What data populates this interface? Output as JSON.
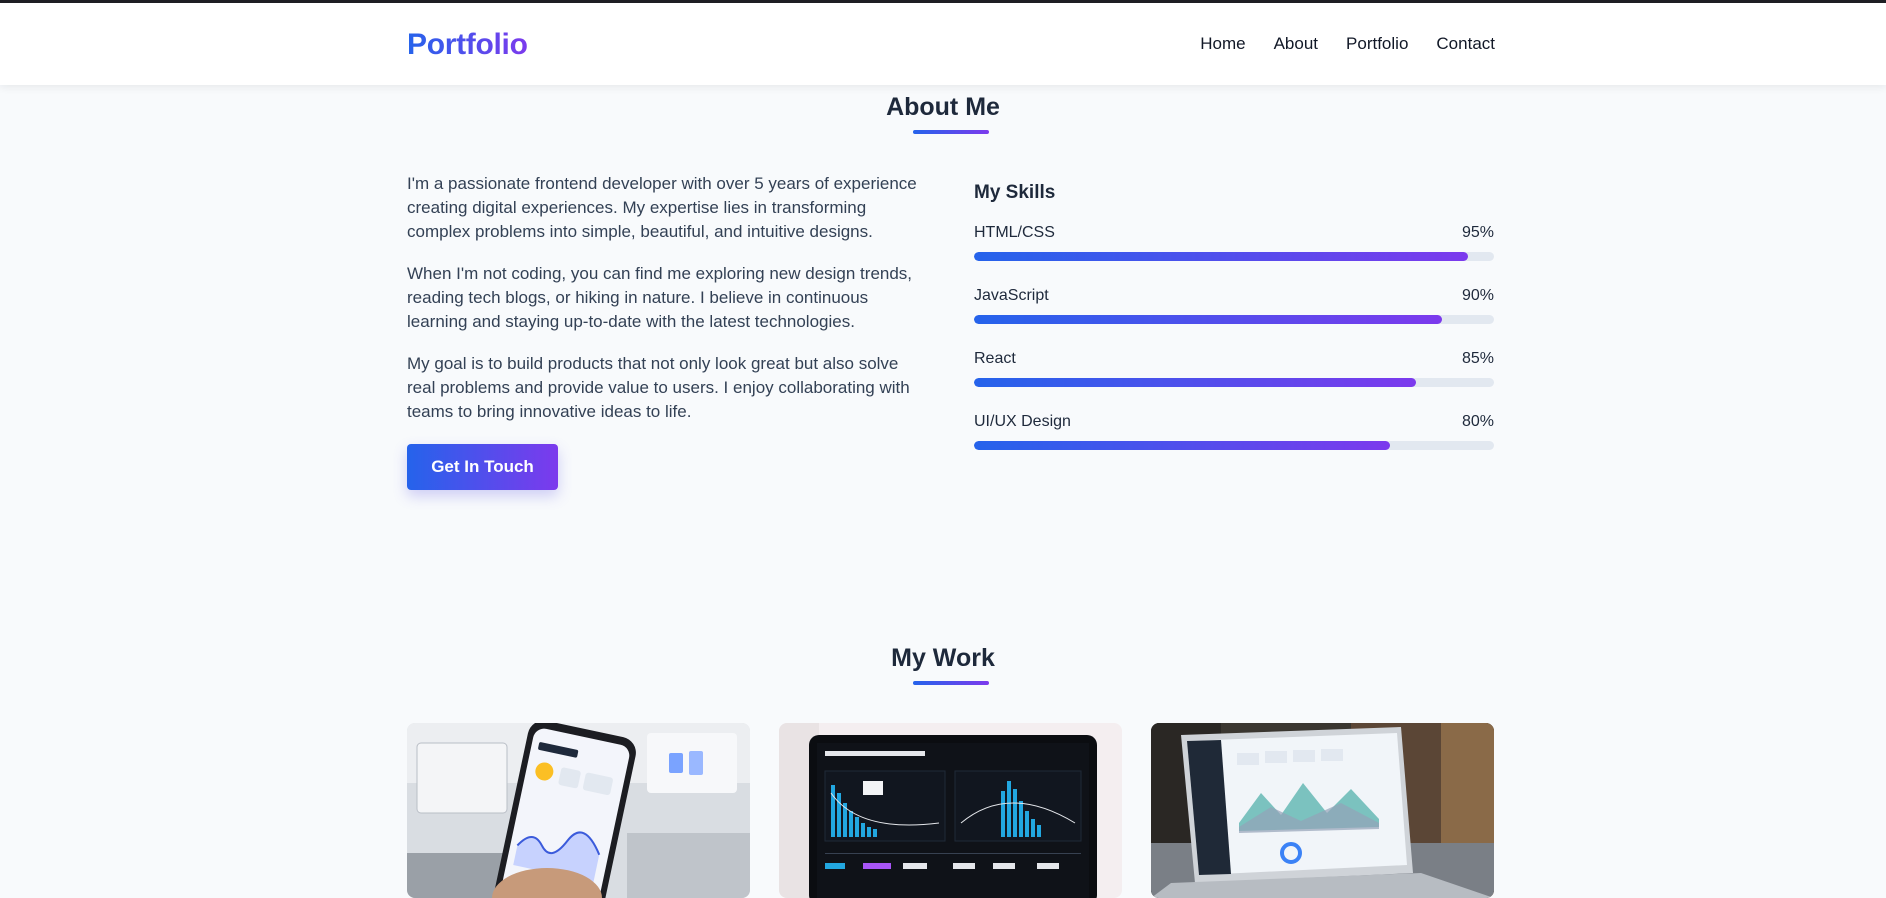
{
  "header": {
    "logo": "Portfolio",
    "nav": [
      "Home",
      "About",
      "Portfolio",
      "Contact"
    ]
  },
  "about": {
    "title": "About Me",
    "paragraphs": [
      "I'm a passionate frontend developer with over 5 years of experience creating digital experiences. My expertise lies in transforming complex problems into simple, beautiful, and intuitive designs.",
      "When I'm not coding, you can find me exploring new design trends, reading tech blogs, or hiking in nature. I believe in continuous learning and staying up-to-date with the latest technologies.",
      "My goal is to build products that not only look great but also solve real problems and provide value to users. I enjoy collaborating with teams to bring innovative ideas to life."
    ],
    "cta_label": "Get In Touch"
  },
  "skills": {
    "title": "My Skills",
    "items": [
      {
        "name": "HTML/CSS",
        "percent_label": "95%",
        "level": 0.95
      },
      {
        "name": "JavaScript",
        "percent_label": "90%",
        "level": 0.9
      },
      {
        "name": "React",
        "percent_label": "85%",
        "level": 0.85
      },
      {
        "name": "UI/UX Design",
        "percent_label": "80%",
        "level": 0.8
      }
    ]
  },
  "work": {
    "title": "My Work",
    "cards": [
      {
        "image": "phone-app-photo"
      },
      {
        "image": "analytics-laptop-photo"
      },
      {
        "image": "laptop-dashboard-photo"
      }
    ]
  },
  "colors": {
    "accent_start": "#2563eb",
    "accent_end": "#7c3aed",
    "background": "#f8fafc",
    "track": "#e2e8f0"
  }
}
